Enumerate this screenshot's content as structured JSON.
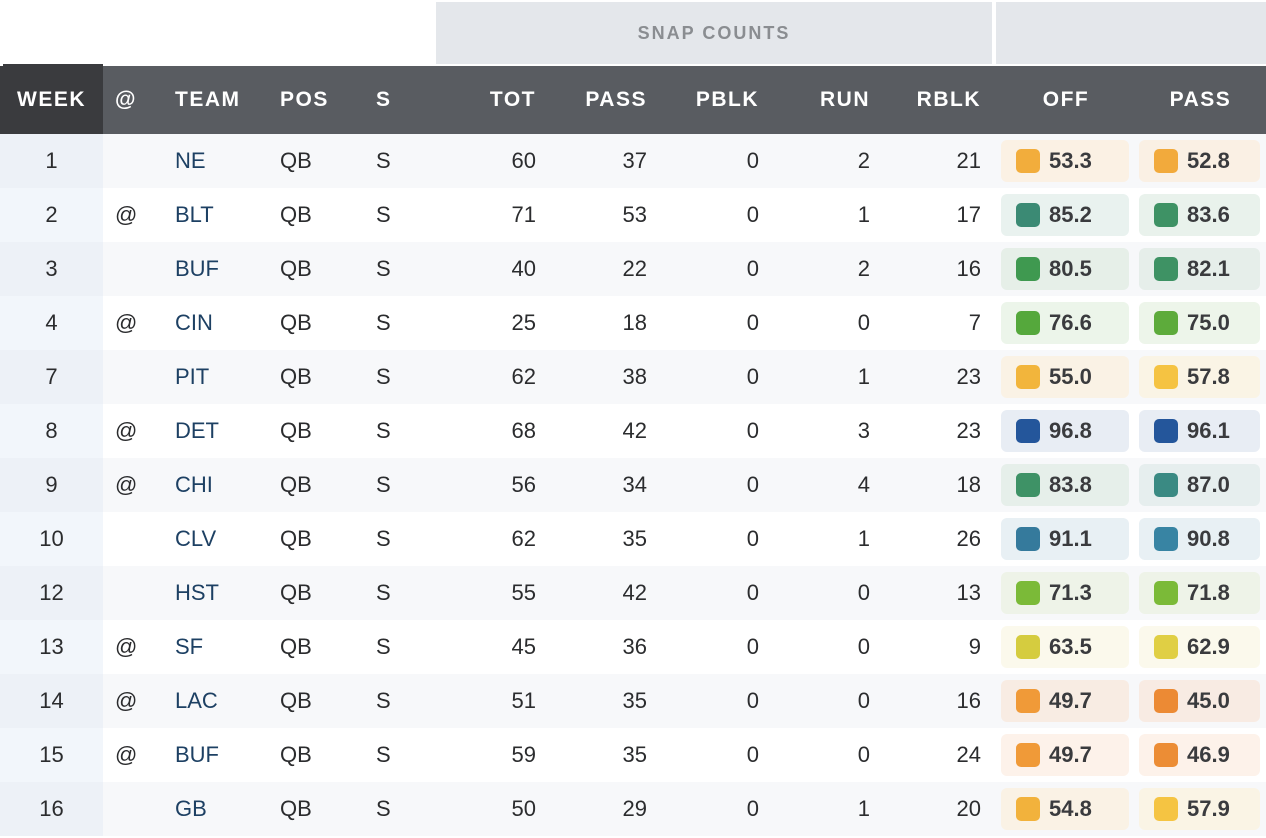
{
  "group_headers": {
    "snap_counts": "SNAP COUNTS",
    "grades": ""
  },
  "columns": {
    "week": "WEEK",
    "at": "@",
    "team": "TEAM",
    "pos": "POS",
    "s": "S",
    "tot": "TOT",
    "pass": "PASS",
    "pblk": "PBLK",
    "run": "RUN",
    "rblk": "RBLK",
    "off": "OFF",
    "grade_pass": "PASS"
  },
  "rows": [
    {
      "week": "1",
      "at": "",
      "team": "NE",
      "pos": "QB",
      "s": "S",
      "tot": "60",
      "pass": "37",
      "pblk": "0",
      "run": "2",
      "rblk": "21",
      "off": {
        "value": "53.3",
        "color": "#f2ad3c",
        "bg": "#fbf1e4"
      },
      "grade_pass": {
        "value": "52.8",
        "color": "#f2aa3c",
        "bg": "#faf0e4"
      }
    },
    {
      "week": "2",
      "at": "@",
      "team": "BLT",
      "pos": "QB",
      "s": "S",
      "tot": "71",
      "pass": "53",
      "pblk": "0",
      "run": "1",
      "rblk": "17",
      "off": {
        "value": "85.2",
        "color": "#3b8a74",
        "bg": "#e9f2ef"
      },
      "grade_pass": {
        "value": "83.6",
        "color": "#3e9265",
        "bg": "#e9f2ec"
      }
    },
    {
      "week": "3",
      "at": "",
      "team": "BUF",
      "pos": "QB",
      "s": "S",
      "tot": "40",
      "pass": "22",
      "pblk": "0",
      "run": "2",
      "rblk": "16",
      "off": {
        "value": "80.5",
        "color": "#3f9950",
        "bg": "#e6efe8"
      },
      "grade_pass": {
        "value": "82.1",
        "color": "#3e9264",
        "bg": "#e6eeea"
      }
    },
    {
      "week": "4",
      "at": "@",
      "team": "CIN",
      "pos": "QB",
      "s": "S",
      "tot": "25",
      "pass": "18",
      "pblk": "0",
      "run": "0",
      "rblk": "7",
      "off": {
        "value": "76.6",
        "color": "#55a83c",
        "bg": "#ecf5ea"
      },
      "grade_pass": {
        "value": "75.0",
        "color": "#5dab3b",
        "bg": "#edf5ea"
      }
    },
    {
      "week": "7",
      "at": "",
      "team": "PIT",
      "pos": "QB",
      "s": "S",
      "tot": "62",
      "pass": "38",
      "pblk": "0",
      "run": "1",
      "rblk": "23",
      "off": {
        "value": "55.0",
        "color": "#f2b53c",
        "bg": "#faf2e5"
      },
      "grade_pass": {
        "value": "57.8",
        "color": "#f5c342",
        "bg": "#faf4e5"
      }
    },
    {
      "week": "8",
      "at": "@",
      "team": "DET",
      "pos": "QB",
      "s": "S",
      "tot": "68",
      "pass": "42",
      "pblk": "0",
      "run": "3",
      "rblk": "23",
      "off": {
        "value": "96.8",
        "color": "#24569b",
        "bg": "#e8edf4"
      },
      "grade_pass": {
        "value": "96.1",
        "color": "#24569b",
        "bg": "#e8edf4"
      }
    },
    {
      "week": "9",
      "at": "@",
      "team": "CHI",
      "pos": "QB",
      "s": "S",
      "tot": "56",
      "pass": "34",
      "pblk": "0",
      "run": "4",
      "rblk": "18",
      "off": {
        "value": "83.8",
        "color": "#3e9266",
        "bg": "#e6efea"
      },
      "grade_pass": {
        "value": "87.0",
        "color": "#3a8a83",
        "bg": "#e6eeee"
      }
    },
    {
      "week": "10",
      "at": "",
      "team": "CLV",
      "pos": "QB",
      "s": "S",
      "tot": "62",
      "pass": "35",
      "pblk": "0",
      "run": "1",
      "rblk": "26",
      "off": {
        "value": "91.1",
        "color": "#357a9c",
        "bg": "#e8f0f4"
      },
      "grade_pass": {
        "value": "90.8",
        "color": "#3884a3",
        "bg": "#e8f0f4"
      }
    },
    {
      "week": "12",
      "at": "",
      "team": "HST",
      "pos": "QB",
      "s": "S",
      "tot": "55",
      "pass": "42",
      "pblk": "0",
      "run": "0",
      "rblk": "13",
      "off": {
        "value": "71.3",
        "color": "#7bba38",
        "bg": "#eef3e8"
      },
      "grade_pass": {
        "value": "71.8",
        "color": "#7bba38",
        "bg": "#eef3e8"
      }
    },
    {
      "week": "13",
      "at": "@",
      "team": "SF",
      "pos": "QB",
      "s": "S",
      "tot": "45",
      "pass": "36",
      "pblk": "0",
      "run": "0",
      "rblk": "9",
      "off": {
        "value": "63.5",
        "color": "#d5cc3f",
        "bg": "#fbf9ec"
      },
      "grade_pass": {
        "value": "62.9",
        "color": "#e0cf44",
        "bg": "#fbf9ec"
      }
    },
    {
      "week": "14",
      "at": "@",
      "team": "LAC",
      "pos": "QB",
      "s": "S",
      "tot": "51",
      "pass": "35",
      "pblk": "0",
      "run": "0",
      "rblk": "16",
      "off": {
        "value": "49.7",
        "color": "#f09a38",
        "bg": "#f8ece3"
      },
      "grade_pass": {
        "value": "45.0",
        "color": "#ec8a34",
        "bg": "#f8ebe3"
      }
    },
    {
      "week": "15",
      "at": "@",
      "team": "BUF",
      "pos": "QB",
      "s": "S",
      "tot": "59",
      "pass": "35",
      "pblk": "0",
      "run": "0",
      "rblk": "24",
      "off": {
        "value": "49.7",
        "color": "#f09a38",
        "bg": "#fdf2ea"
      },
      "grade_pass": {
        "value": "46.9",
        "color": "#ec8d35",
        "bg": "#fdf2ea"
      }
    },
    {
      "week": "16",
      "at": "",
      "team": "GB",
      "pos": "QB",
      "s": "S",
      "tot": "50",
      "pass": "29",
      "pblk": "0",
      "run": "1",
      "rblk": "20",
      "off": {
        "value": "54.8",
        "color": "#f2b23c",
        "bg": "#faf2e5"
      },
      "grade_pass": {
        "value": "57.9",
        "color": "#f5c442",
        "bg": "#faf4e5"
      }
    }
  ]
}
